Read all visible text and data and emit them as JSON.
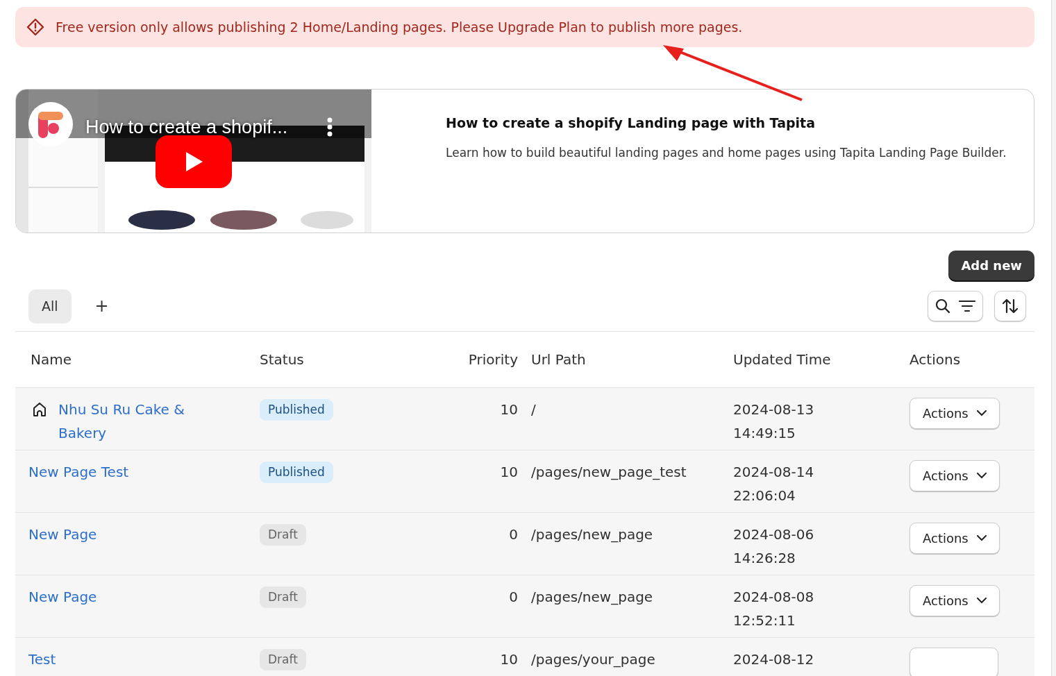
{
  "alert": {
    "text": "Free version only allows publishing 2 Home/Landing pages. Please Upgrade Plan to publish more pages."
  },
  "video": {
    "overlay_title": "How to create a shopif...",
    "title": "How to create a shopify Landing page with Tapita",
    "description": "Learn how to build beautiful landing pages and home pages using Tapita Landing Page Builder."
  },
  "add_button": "Add new",
  "tabs": [
    {
      "label": "All",
      "selected": true
    }
  ],
  "add_tab": "+",
  "table": {
    "columns": [
      "Name",
      "Status",
      "Priority",
      "Url Path",
      "Updated Time",
      "Actions"
    ],
    "rows": [
      {
        "home": true,
        "name": "Nhu Su Ru Cake & Bakery",
        "status": "Published",
        "published": true,
        "priority": "10",
        "url": "/",
        "date": "2024-08-13",
        "time": "14:49:15",
        "action": "Actions"
      },
      {
        "home": false,
        "name": "New Page Test",
        "status": "Published",
        "published": true,
        "priority": "10",
        "url": "/pages/new_page_test",
        "date": "2024-08-14",
        "time": "22:06:04",
        "action": "Actions"
      },
      {
        "home": false,
        "name": "New Page",
        "status": "Draft",
        "published": false,
        "priority": "0",
        "url": "/pages/new_page",
        "date": "2024-08-06",
        "time": "14:26:28",
        "action": "Actions"
      },
      {
        "home": false,
        "name": "New Page",
        "status": "Draft",
        "published": false,
        "priority": "0",
        "url": "/pages/new_page",
        "date": "2024-08-08",
        "time": "12:52:11",
        "action": "Actions"
      },
      {
        "home": false,
        "name": "Test",
        "status": "Draft",
        "published": false,
        "priority": "10",
        "url": "/pages/your_page",
        "date": "2024-08-12"
      }
    ]
  }
}
